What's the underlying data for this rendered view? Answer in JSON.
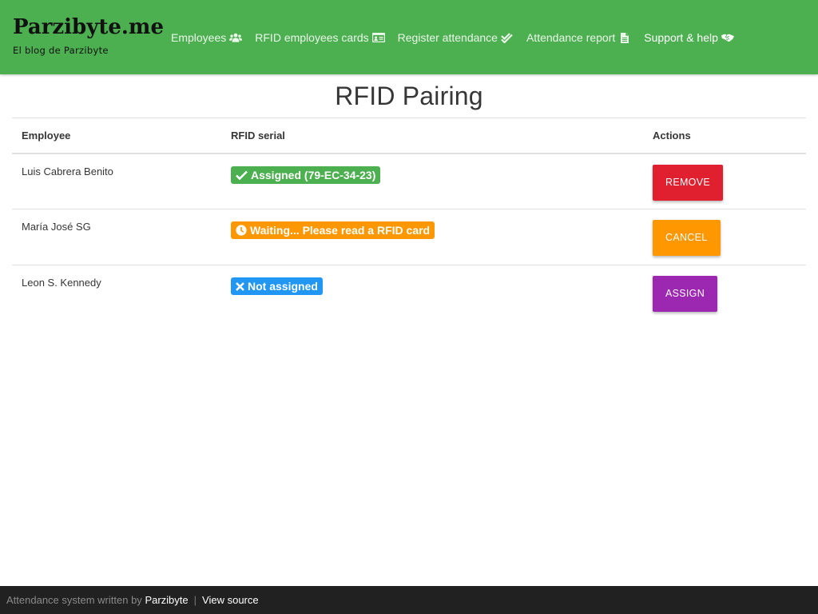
{
  "brand": {
    "title": "Parzibyte.me",
    "subtitle": "El blog de Parzibyte"
  },
  "nav": {
    "items": [
      {
        "label": "Employees",
        "icon": "users-icon"
      },
      {
        "label": "RFID employees cards",
        "icon": "id-card-icon"
      },
      {
        "label": "Register attendance",
        "icon": "check-double-icon"
      },
      {
        "label": "Attendance report",
        "icon": "file-icon"
      },
      {
        "label": "Support & help",
        "icon": "handshake-icon"
      }
    ]
  },
  "page": {
    "title": "RFID Pairing"
  },
  "table": {
    "headers": {
      "employee": "Employee",
      "rfid": "RFID serial",
      "actions": "Actions"
    },
    "rows": [
      {
        "employee": "Luis Cabrera Benito",
        "status": "Assigned (79-EC-34-23)",
        "status_icon": "check-icon",
        "status_color": "#4caf50",
        "action": "Remove",
        "action_color": "#e0202e"
      },
      {
        "employee": "María José SG",
        "status": "Waiting... Please read a RFID card",
        "status_icon": "clock-icon",
        "status_color": "#ff9800",
        "action": "Cancel",
        "action_color": "#ff9800"
      },
      {
        "employee": "Leon S. Kennedy",
        "status": "Not assigned",
        "status_icon": "times-icon",
        "status_color": "#2196f3",
        "action": "Assign",
        "action_color": "#9c27b0"
      }
    ]
  },
  "footer": {
    "prefix": "Attendance system written by",
    "author_link": "Parzibyte",
    "separator": "|",
    "source_link": "View source"
  },
  "colors": {
    "navbar": "#4caf50",
    "footer": "#212121"
  }
}
